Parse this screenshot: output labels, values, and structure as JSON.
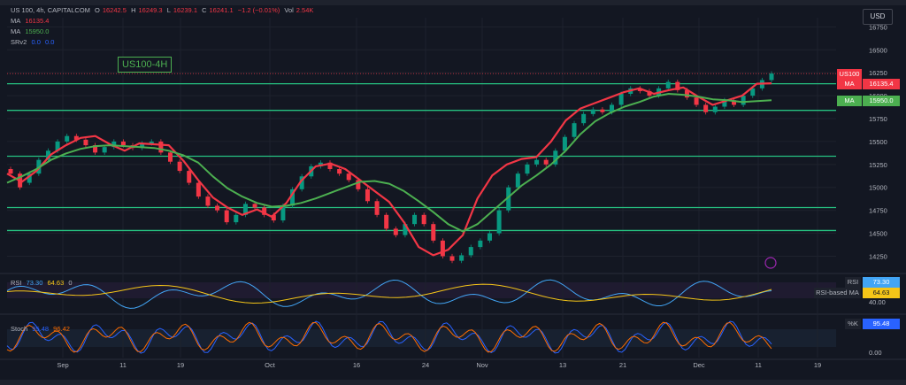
{
  "instrument": {
    "symbol": "US 100, 4h, CAPITALCOM",
    "open_label": "O",
    "open": "16242.5",
    "high_label": "H",
    "high": "16249.3",
    "low_label": "L",
    "low": "16239.1",
    "close_label": "C",
    "close": "16241.1",
    "change": "−1.2 (−0.01%)",
    "volume_label": "Vol",
    "volume": "2.54K"
  },
  "indicators": {
    "ma1_label": "MA",
    "ma1_value": "16135.4",
    "ma2_label": "MA",
    "ma2_value": "15950.0",
    "srv2_label": "SRv2",
    "srv2_a": "0.0",
    "srv2_b": "0.0"
  },
  "chart_label": "US100-4H",
  "currency_button": "USD",
  "price_tags": {
    "symbol_tag": "US100",
    "ma1_tag": "MA",
    "ma1_value": "16135.4",
    "ma2_tag": "MA",
    "ma2_value": "15950.0"
  },
  "rsi_panel": {
    "label": "RSI",
    "rsi_value_a": "73.30",
    "rsi_value_b": "64.63",
    "tail": "0",
    "rsi_tag": "RSI",
    "rsi_tag_value": "73.30",
    "ma_tag": "RSI-based MA",
    "ma_tag_value": "64.63",
    "axis_label": "40.00"
  },
  "stoch_panel": {
    "label": "Stoch",
    "k_value": "95.48",
    "d_value": "96.42",
    "k_tag": "%K",
    "k_tag_value": "95.48",
    "axis_label": "0.00"
  },
  "colors": {
    "background": "#131722",
    "bull": "#089981",
    "bear": "#f23645",
    "ma_fast": "#f23645",
    "ma_slow": "#4caf50",
    "sr_lines": "#26c281",
    "rsi_line": "#42a5f5",
    "rsi_ma": "#f5c518",
    "stoch_k": "#2962ff",
    "stoch_d": "#ff6d00"
  },
  "chart_data": {
    "type": "line",
    "title": "US100-4H",
    "y_ticks": [
      16750,
      16500,
      16250,
      16000,
      15750,
      15500,
      15250,
      15000,
      14750,
      14500,
      14250
    ],
    "ylim": [
      14100,
      16850
    ],
    "x_ticks": [
      "Sep",
      "11",
      "19",
      "Oct",
      "16",
      "24",
      "Nov",
      "13",
      "21",
      "Dec",
      "11",
      "19"
    ],
    "horizontal_levels": [
      16130,
      15840,
      15340,
      14780,
      14530
    ],
    "series": [
      {
        "name": "MA",
        "values": [
          15150,
          15060,
          15180,
          15360,
          15460,
          15540,
          15560,
          15470,
          15400,
          15480,
          15470,
          15460,
          15290,
          15080,
          14890,
          14780,
          14700,
          14760,
          14680,
          14830,
          15070,
          15230,
          15260,
          15200,
          15080,
          14960,
          14840,
          14620,
          14350,
          14260,
          14320,
          14480,
          14880,
          15130,
          15250,
          15310,
          15330,
          15500,
          15730,
          15860,
          15920,
          15980,
          16040,
          16080,
          16020,
          16060,
          16090,
          15990,
          15900,
          15950,
          16000,
          16130,
          16135.4
        ]
      },
      {
        "name": "MA",
        "values": [
          15050,
          15120,
          15200,
          15300,
          15370,
          15420,
          15450,
          15460,
          15450,
          15440,
          15430,
          15400,
          15350,
          15270,
          15120,
          14990,
          14900,
          14830,
          14790,
          14800,
          14830,
          14880,
          14940,
          15000,
          15060,
          15070,
          15040,
          14960,
          14850,
          14730,
          14600,
          14520,
          14600,
          14740,
          14880,
          15020,
          15130,
          15250,
          15400,
          15580,
          15720,
          15810,
          15880,
          15930,
          15990,
          16020,
          16010,
          15990,
          15960,
          15950,
          15930,
          15940,
          15950.0
        ]
      }
    ],
    "candles": [
      [
        15200,
        15150
      ],
      [
        15150,
        15000
      ],
      [
        15050,
        15150
      ],
      [
        15150,
        15300
      ],
      [
        15300,
        15400
      ],
      [
        15400,
        15500
      ],
      [
        15500,
        15560
      ],
      [
        15560,
        15520
      ],
      [
        15520,
        15460
      ],
      [
        15460,
        15380
      ],
      [
        15380,
        15440
      ],
      [
        15440,
        15500
      ],
      [
        15500,
        15460
      ],
      [
        15460,
        15430
      ],
      [
        15430,
        15480
      ],
      [
        15480,
        15500
      ],
      [
        15500,
        15380
      ],
      [
        15380,
        15280
      ],
      [
        15280,
        15180
      ],
      [
        15180,
        15050
      ],
      [
        15050,
        14900
      ],
      [
        14900,
        14800
      ],
      [
        14800,
        14750
      ],
      [
        14750,
        14620
      ],
      [
        14620,
        14700
      ],
      [
        14700,
        14820
      ],
      [
        14820,
        14780
      ],
      [
        14780,
        14700
      ],
      [
        14700,
        14640
      ],
      [
        14640,
        14800
      ],
      [
        14800,
        14980
      ],
      [
        14980,
        15120
      ],
      [
        15120,
        15230
      ],
      [
        15230,
        15270
      ],
      [
        15270,
        15200
      ],
      [
        15200,
        15150
      ],
      [
        15150,
        15080
      ],
      [
        15080,
        14980
      ],
      [
        14980,
        14850
      ],
      [
        14850,
        14700
      ],
      [
        14700,
        14550
      ],
      [
        14550,
        14480
      ],
      [
        14480,
        14600
      ],
      [
        14600,
        14700
      ],
      [
        14700,
        14600
      ],
      [
        14600,
        14420
      ],
      [
        14420,
        14250
      ],
      [
        14250,
        14200
      ],
      [
        14200,
        14260
      ],
      [
        14260,
        14350
      ],
      [
        14350,
        14420
      ],
      [
        14420,
        14500
      ],
      [
        14500,
        14750
      ],
      [
        14750,
        15000
      ],
      [
        15000,
        15150
      ],
      [
        15150,
        15250
      ],
      [
        15250,
        15300
      ],
      [
        15300,
        15250
      ],
      [
        15250,
        15400
      ],
      [
        15400,
        15550
      ],
      [
        15550,
        15700
      ],
      [
        15700,
        15800
      ],
      [
        15800,
        15850
      ],
      [
        15850,
        15820
      ],
      [
        15820,
        15900
      ],
      [
        15900,
        16020
      ],
      [
        16020,
        16080
      ],
      [
        16080,
        16050
      ],
      [
        16050,
        16000
      ],
      [
        16000,
        16080
      ],
      [
        16080,
        16150
      ],
      [
        16150,
        16060
      ],
      [
        16060,
        15980
      ],
      [
        15980,
        15900
      ],
      [
        15900,
        15820
      ],
      [
        15820,
        15880
      ],
      [
        15880,
        15950
      ],
      [
        15950,
        15900
      ],
      [
        15900,
        16000
      ],
      [
        16000,
        16080
      ],
      [
        16080,
        16170
      ],
      [
        16170,
        16241.1
      ]
    ]
  }
}
